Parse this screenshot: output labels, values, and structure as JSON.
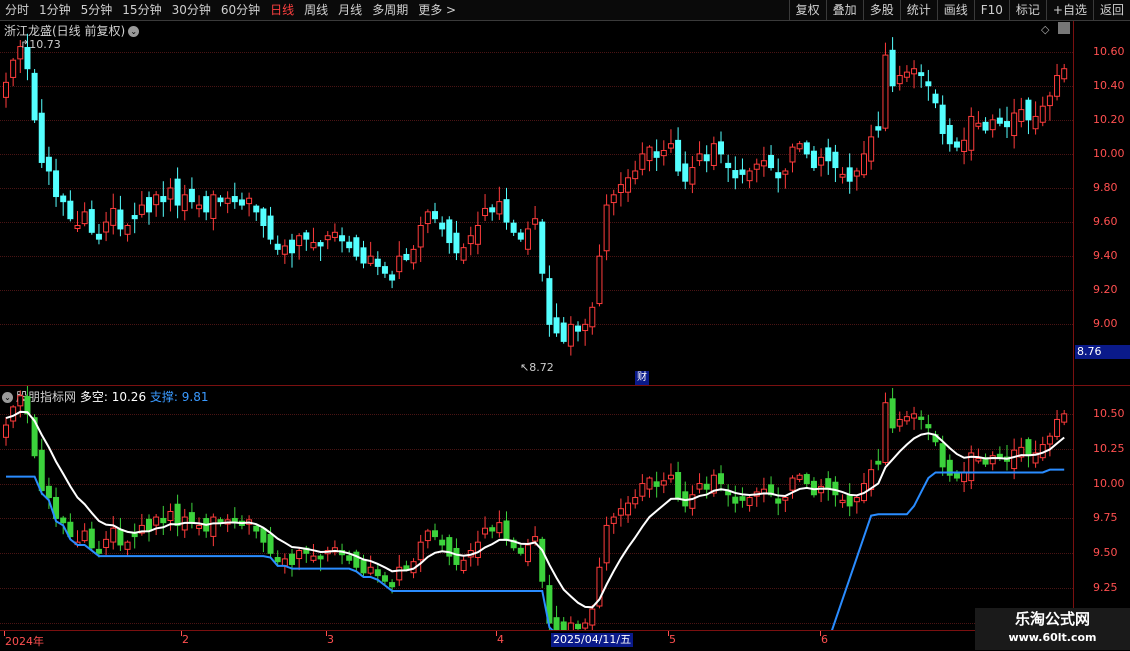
{
  "toolbar": {
    "left": [
      "分时",
      "1分钟",
      "5分钟",
      "15分钟",
      "30分钟",
      "60分钟",
      "日线",
      "周线",
      "月线",
      "多周期",
      "更多 >"
    ],
    "active_index": 6,
    "right": [
      "复权",
      "叠加",
      "多股",
      "统计",
      "画线",
      "F10",
      "标记",
      "+自选",
      "返回"
    ]
  },
  "main_chart": {
    "title": "浙江龙盛(日线 前复权)",
    "high_label": "10.73",
    "low_label": "8.72",
    "y_ticks": [
      "10.60",
      "10.40",
      "10.20",
      "10.00",
      "9.80",
      "9.60",
      "9.40",
      "9.20",
      "9.00"
    ],
    "y_tick_values": [
      10.6,
      10.4,
      10.2,
      10.0,
      9.8,
      9.6,
      9.4,
      9.2,
      9.0
    ],
    "price_tag": "8.76",
    "event_marker": "财"
  },
  "indicator": {
    "name": "股朋指标网",
    "duokong_label": "多空:",
    "duokong_value": "10.26",
    "support_label": "支撑:",
    "support_value": "9.81",
    "y_ticks": [
      "10.50",
      "10.25",
      "10.00",
      "9.75",
      "9.50",
      "9.25",
      "9.00"
    ],
    "y_tick_values": [
      10.5,
      10.25,
      10.0,
      9.75,
      9.5,
      9.25,
      9.0
    ]
  },
  "date_axis": {
    "labels": [
      "2024年",
      "2",
      "3",
      "4",
      "5",
      "6"
    ],
    "selected_date": "2025/04/11/五"
  },
  "watermark": {
    "line1": "乐淘公式网",
    "line2": "www.60lt.com"
  },
  "colors": {
    "up": "#ff3c3c",
    "down": "#54ffff",
    "ind_down": "#3cd23c",
    "duokong_line": "#ffffff",
    "support_line": "#2a8cff",
    "axis": "#ff5050"
  },
  "chart_data": {
    "type": "candlestick",
    "title": "浙江龙盛(日线 前复权)",
    "ylim_main": [
      8.65,
      10.78
    ],
    "ylim_indicator": [
      8.95,
      10.7
    ],
    "close": [
      10.42,
      10.55,
      10.63,
      10.5,
      10.2,
      9.95,
      9.9,
      9.75,
      9.72,
      9.62,
      9.58,
      9.66,
      9.54,
      9.5,
      9.6,
      9.68,
      9.56,
      9.58,
      9.62,
      9.7,
      9.66,
      9.76,
      9.72,
      9.8,
      9.7,
      9.76,
      9.72,
      9.7,
      9.66,
      9.76,
      9.72,
      9.74,
      9.72,
      9.7,
      9.74,
      9.66,
      9.58,
      9.5,
      9.44,
      9.46,
      9.42,
      9.52,
      9.5,
      9.48,
      9.46,
      9.52,
      9.54,
      9.49,
      9.45,
      9.4,
      9.36,
      9.4,
      9.34,
      9.3,
      9.26,
      9.4,
      9.38,
      9.44,
      9.58,
      9.66,
      9.62,
      9.56,
      9.48,
      9.42,
      9.45,
      9.52,
      9.58,
      9.68,
      9.66,
      9.72,
      9.6,
      9.54,
      9.5,
      9.56,
      9.62,
      9.3,
      9.0,
      8.95,
      8.9,
      9.0,
      8.96,
      9.0,
      9.1,
      9.4,
      9.7,
      9.76,
      9.82,
      9.86,
      9.9,
      10.0,
      10.04,
      9.98,
      10.02,
      10.06,
      9.9,
      9.84,
      9.92,
      10.0,
      9.96,
      10.06,
      10.0,
      9.92,
      9.86,
      9.88,
      9.9,
      9.94,
      9.96,
      9.92,
      9.86,
      9.9,
      10.04,
      10.06,
      10.0,
      9.92,
      9.98,
      9.96,
      9.92,
      9.88,
      9.84,
      9.9,
      10.0,
      10.1,
      10.14,
      10.58,
      10.4,
      10.46,
      10.48,
      10.5,
      10.46,
      10.4,
      10.3,
      10.12,
      10.06,
      10.04,
      10.08,
      10.22,
      10.18,
      10.14,
      10.2,
      10.18,
      10.16,
      10.24,
      10.26,
      10.2,
      10.22,
      10.28,
      10.34,
      10.46,
      10.5
    ]
  }
}
